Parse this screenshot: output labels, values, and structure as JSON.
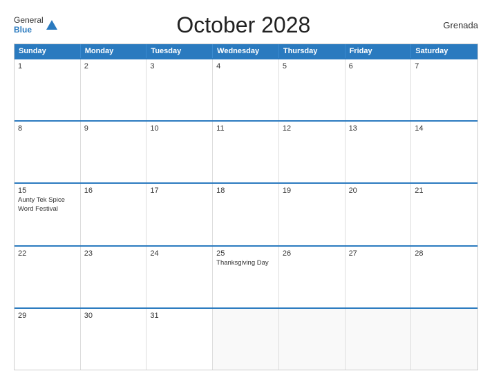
{
  "header": {
    "logo_general": "General",
    "logo_blue": "Blue",
    "title": "October 2028",
    "country": "Grenada"
  },
  "calendar": {
    "day_headers": [
      "Sunday",
      "Monday",
      "Tuesday",
      "Wednesday",
      "Thursday",
      "Friday",
      "Saturday"
    ],
    "weeks": [
      [
        {
          "num": "1",
          "events": []
        },
        {
          "num": "2",
          "events": []
        },
        {
          "num": "3",
          "events": []
        },
        {
          "num": "4",
          "events": []
        },
        {
          "num": "5",
          "events": []
        },
        {
          "num": "6",
          "events": []
        },
        {
          "num": "7",
          "events": []
        }
      ],
      [
        {
          "num": "8",
          "events": []
        },
        {
          "num": "9",
          "events": []
        },
        {
          "num": "10",
          "events": []
        },
        {
          "num": "11",
          "events": []
        },
        {
          "num": "12",
          "events": []
        },
        {
          "num": "13",
          "events": []
        },
        {
          "num": "14",
          "events": []
        }
      ],
      [
        {
          "num": "15",
          "events": [
            "Aunty Tek Spice Word Festival"
          ]
        },
        {
          "num": "16",
          "events": []
        },
        {
          "num": "17",
          "events": []
        },
        {
          "num": "18",
          "events": []
        },
        {
          "num": "19",
          "events": []
        },
        {
          "num": "20",
          "events": []
        },
        {
          "num": "21",
          "events": []
        }
      ],
      [
        {
          "num": "22",
          "events": []
        },
        {
          "num": "23",
          "events": []
        },
        {
          "num": "24",
          "events": []
        },
        {
          "num": "25",
          "events": [
            "Thanksgiving Day"
          ]
        },
        {
          "num": "26",
          "events": []
        },
        {
          "num": "27",
          "events": []
        },
        {
          "num": "28",
          "events": []
        }
      ],
      [
        {
          "num": "29",
          "events": []
        },
        {
          "num": "30",
          "events": []
        },
        {
          "num": "31",
          "events": []
        },
        {
          "num": "",
          "events": []
        },
        {
          "num": "",
          "events": []
        },
        {
          "num": "",
          "events": []
        },
        {
          "num": "",
          "events": []
        }
      ]
    ]
  }
}
